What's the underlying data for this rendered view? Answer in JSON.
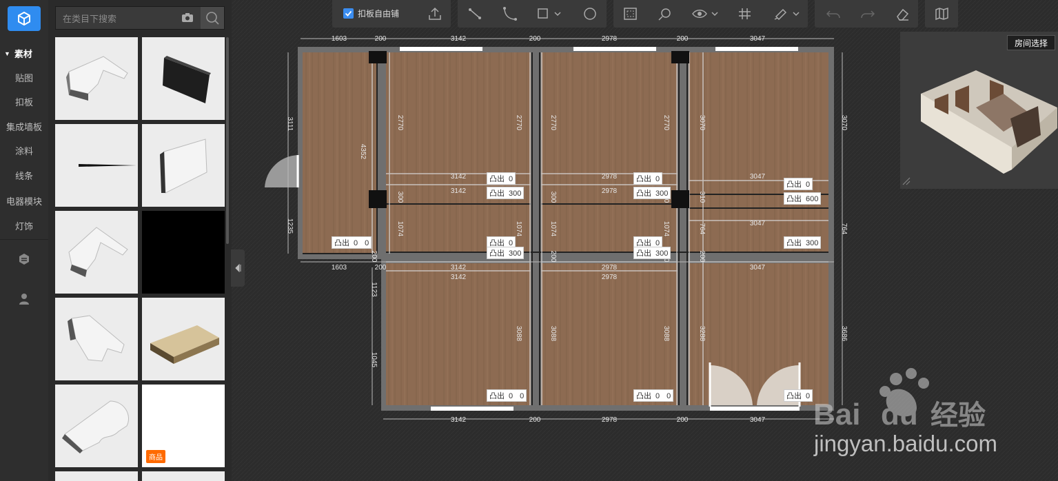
{
  "rail": {
    "section_header": "素材",
    "items": [
      "贴图",
      "扣板",
      "集成墙板",
      "涂料",
      "线条",
      "电器模块",
      "灯饰"
    ],
    "icons": [
      "cube-logo-icon",
      "shield-icon",
      "user-icon"
    ]
  },
  "panel": {
    "search_placeholder": "在类目下搜索",
    "badge": "商品"
  },
  "toolbar": {
    "free_tile_label": "扣板自由铺",
    "free_tile_checked": true,
    "icons": [
      "upload-icon",
      "line-tool-icon",
      "arc-tool-icon",
      "rect-tool-icon",
      "circle-tool-icon",
      "select-area-icon",
      "zoom-icon",
      "eye-icon",
      "grid-icon",
      "paint-icon",
      "undo-icon",
      "redo-icon",
      "eraser-icon",
      "map-icon"
    ]
  },
  "preview": {
    "room_select_label": "房间选择"
  },
  "plan": {
    "top_dims": [
      "1603",
      "200",
      "3142",
      "200",
      "2978",
      "200",
      "3047"
    ],
    "mid_dims_a": [
      "3142",
      "2978",
      "3047"
    ],
    "mid_dims_b": [
      "3142",
      "2978"
    ],
    "row_dims_c": [
      "3047"
    ],
    "bottom_top_dims": [
      "1603",
      "200",
      "3142",
      "200",
      "2978",
      "3047"
    ],
    "bottom_top_dims2": [
      "3142",
      "2978"
    ],
    "bottom_dims": [
      "3142",
      "200",
      "2978",
      "200",
      "3047"
    ],
    "left_dims": [
      "3111",
      "1235"
    ],
    "left2_dims": [
      "4352"
    ],
    "vert_dims_top": [
      "2770",
      "2770",
      "2770",
      "2770",
      "3070",
      "3070"
    ],
    "vert_dims_small": [
      "300",
      "300",
      "310",
      "310"
    ],
    "vert_dims_mid": [
      "1074",
      "1074",
      "1074",
      "1074",
      "764",
      "764"
    ],
    "vert_dims_bottom": [
      "3088",
      "3088",
      "3088",
      "3288",
      "3686"
    ],
    "vert_dims_left_bottom": [
      "1123",
      "1045"
    ],
    "vert_dims_tiny": [
      "200",
      "200",
      "200",
      "200"
    ],
    "labels": [
      {
        "k": "凸出",
        "v": "0"
      },
      {
        "k": "凸出",
        "v": "300"
      },
      {
        "k": "凸出",
        "v": "0"
      },
      {
        "k": "凸出",
        "v": "300"
      },
      {
        "k": "凸出",
        "v": "0"
      },
      {
        "k": "凸出",
        "v": "600"
      },
      {
        "k": "凸出",
        "v": "0",
        "v2": "0"
      },
      {
        "k": "凸出",
        "v": "0"
      },
      {
        "k": "凸出",
        "v": "300"
      },
      {
        "k": "凸出",
        "v": "0"
      },
      {
        "k": "凸出",
        "v": "300"
      },
      {
        "k": "凸出",
        "v": "300"
      },
      {
        "k": "凸出",
        "v": "0",
        "v2": "0"
      },
      {
        "k": "凸出",
        "v": "0",
        "v2": "0"
      },
      {
        "k": "凸出",
        "v": "0"
      }
    ]
  },
  "watermark": {
    "text": "jingyan.baidu.com",
    "brand": "Bai du 经验"
  },
  "colors": {
    "accent": "#2f8cf0",
    "wood": "#8a6a52",
    "badge": "#ff6a00"
  }
}
